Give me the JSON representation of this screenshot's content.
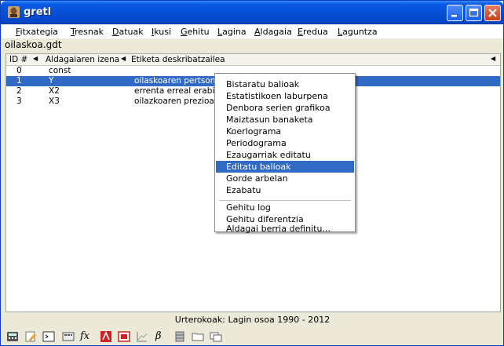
{
  "window": {
    "title": "gretl"
  },
  "menubar": {
    "items": [
      {
        "first": "F",
        "rest": "itxategia"
      },
      {
        "first": "T",
        "rest": "resnak"
      },
      {
        "first": "D",
        "rest": "atuak"
      },
      {
        "first": "I",
        "rest": "kusi"
      },
      {
        "first": "G",
        "rest": "ehitu"
      },
      {
        "first": "L",
        "rest": "agina"
      },
      {
        "first": "A",
        "rest": "ldagaia"
      },
      {
        "first": "E",
        "rest": "redua"
      },
      {
        "first": "L",
        "rest": "aguntza"
      }
    ]
  },
  "file": {
    "name": "oilaskoa.gdt"
  },
  "table": {
    "headers": {
      "id": "ID #",
      "name": "Aldagaiaren izena",
      "label": "Etiketa deskribatzailea"
    },
    "rows": [
      {
        "id": "0",
        "name": "const",
        "label": ""
      },
      {
        "id": "1",
        "name": "Y",
        "label": "oilaskoaren pertsona"
      },
      {
        "id": "2",
        "name": "X2",
        "label": "errenta erreal erabil"
      },
      {
        "id": "3",
        "name": "X3",
        "label": "oilazkoaren prezioa, e"
      }
    ],
    "selected_index": 1
  },
  "context_menu": {
    "items": [
      "Bistaratu balioak",
      "Estatistikoen laburpena",
      "Denbora serien grafikoa",
      "Maiztasun banaketa",
      "Koerlograma",
      "Periodograma",
      "Ezaugarriak editatu",
      "Editatu balioak",
      "Gorde arbelan",
      "Ezabatu",
      "Gehitu log",
      "Gehitu diferentzia",
      "Aldagai berria definitu..."
    ],
    "highlighted_index": 7
  },
  "status": {
    "text": "Urterokoak: Lagin osoa 1990 - 2012"
  },
  "toolbar": {
    "icons": [
      "calculator-icon",
      "edit-icon",
      "terminal-icon",
      "session-icon",
      "function-icon",
      "pdf-icon",
      "model-icon",
      "graph-icon",
      "beta-icon",
      "database-icon",
      "folder-icon",
      "windows-icon"
    ],
    "fx_label": "fx",
    "beta_label": "β"
  },
  "colors": {
    "selection": "#316ac5",
    "title_bar": "#0650d8",
    "close": "#c5401c"
  }
}
